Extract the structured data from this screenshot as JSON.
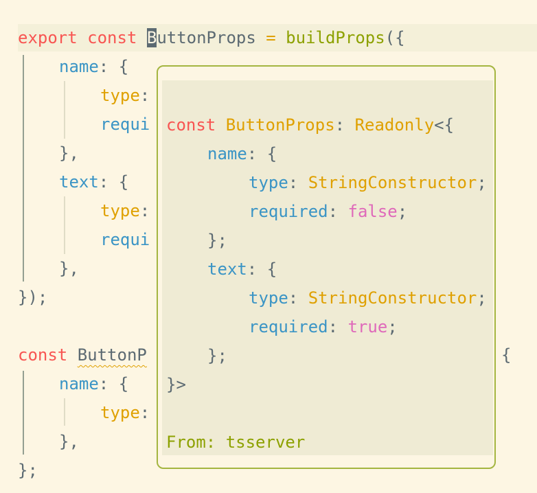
{
  "editor": {
    "line1": {
      "kw1": "export",
      "kw2": "const",
      "cursor_char": "B",
      "ident_rest": "uttonProps",
      "op": "=",
      "fn": "buildProps",
      "open": "({"
    },
    "line2": {
      "prop": "name",
      "rest": ": {"
    },
    "line3": {
      "prop": "type",
      "rest": ":"
    },
    "line4": {
      "prop": "requi"
    },
    "line5": {
      "text": "},"
    },
    "line6": {
      "prop": "text",
      "rest": ": {"
    },
    "line7": {
      "prop": "type",
      "rest": ":"
    },
    "line8": {
      "prop": "requi"
    },
    "line9": {
      "text": "},"
    },
    "line10": {
      "text": "});"
    },
    "line12": {
      "kw": "const",
      "ident": "ButtonP",
      "tail": "{"
    },
    "line13": {
      "prop": "name",
      "rest": ": {"
    },
    "line14": {
      "prop": "type",
      "rest": ":"
    },
    "line15": {
      "text": "},"
    },
    "line16": {
      "text": "};"
    }
  },
  "hover": {
    "l1": {
      "kw": "const",
      "name": "ButtonProps",
      "colon": ":",
      "type": "Readonly",
      "open": "<{"
    },
    "l2": {
      "prop": "name",
      "rest": ": {"
    },
    "l3": {
      "prop": "type",
      "colon": ":",
      "type": "StringConstructor",
      "semi": ";"
    },
    "l4": {
      "prop": "required",
      "colon": ":",
      "value": "false",
      "semi": ";"
    },
    "l5": {
      "text": "};"
    },
    "l6": {
      "prop": "text",
      "rest": ": {"
    },
    "l7": {
      "prop": "type",
      "colon": ":",
      "type": "StringConstructor",
      "semi": ";"
    },
    "l8": {
      "prop": "required",
      "colon": ":",
      "value": "true",
      "semi": ";"
    },
    "l9": {
      "text": "};"
    },
    "l10": {
      "text": "}>"
    },
    "source": "From: tsserver"
  },
  "colors": {
    "background": "#fdf6e3",
    "keyword": "#f85552",
    "function": "#8da101",
    "property": "#3a94c5",
    "type": "#dfa000",
    "boolean": "#df69ba",
    "hover_border": "#a4b540"
  }
}
